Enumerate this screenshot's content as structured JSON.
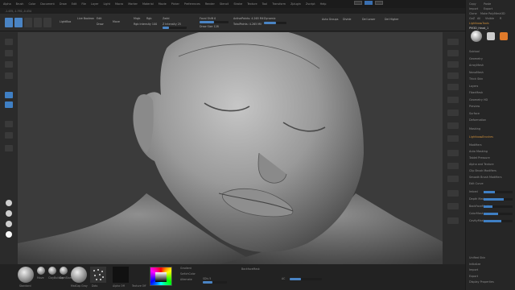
{
  "menu": [
    "Alpha",
    "Brush",
    "Color",
    "Document",
    "Draw",
    "Edit",
    "File",
    "Layer",
    "Light",
    "Macro",
    "Marker",
    "Material",
    "Movie",
    "Picker",
    "Preferences",
    "Render",
    "Stencil",
    "Stroke",
    "Texture",
    "Tool",
    "Transform",
    "Zplugin",
    "Zscript",
    "Help"
  ],
  "coords": "-1.435,-1.792,-0.434",
  "toolbar": {
    "lightbox": "LightBox",
    "live_boolean": "Live Boolean",
    "edit": "Edit",
    "draw": "Draw",
    "move": "Move",
    "scale": "Scale",
    "rotate": "Rotate",
    "mrgb": "Mrgb",
    "rgb": "Rgb",
    "m": "M",
    "zadd": "Zadd",
    "zsub": "Zsub",
    "zcut": "Zcut",
    "focal_shift": "Focal Shift 0",
    "draw_size": "Draw Size 128",
    "z_intensity": "Z Intensity 25",
    "rgb_intensity": "Rgb Intensity 100",
    "dynamic": "Dynamic",
    "activepoints": "ActivePoints: 4.265 Mil",
    "totalpoints": "TotalPoints: 4.265 Mil",
    "auto_groups": "Auto Groups",
    "divide": "Divide",
    "del_lower": "Del Lower",
    "del_higher": "Del Higher"
  },
  "levels": {
    "focal_shift": 0.5,
    "draw_size": 0.55,
    "z_intensity": 0.25,
    "rgb_intensity": 1.0
  },
  "panel": {
    "header": [
      "Copy",
      "Paste",
      "Import",
      "Export",
      "Clone",
      "Make PolyMesh3D",
      "GoZ",
      "All",
      "Visible",
      "R"
    ],
    "lightbox_tools": "Lightbox▸Tools",
    "current_tool": "PM3D_Head_1",
    "sections": [
      "Subtool",
      "Geometry",
      "ArrayMesh",
      "NanoMesh",
      "Thick Skin",
      "Layers",
      "FiberMesh",
      "Geometry HD",
      "Preview",
      "Surface",
      "Deformation"
    ],
    "masking_label": "Masking",
    "lightbox_brushes": "Lightbox▸Brushes",
    "brush_sections": [
      "Modifiers",
      "Auto Masking",
      "Tablet Pressure",
      "Alpha and Texture",
      "Clip Brush Modifiers",
      "Smooth Brush Modifiers",
      "Edit Curve"
    ],
    "sliders": [
      "Imbed",
      "Depth Mask",
      "BackFaceMask",
      "ColorMask",
      "CavityMask"
    ],
    "slider_levels": [
      0.4,
      0.7,
      0.3,
      0.5,
      0.6
    ],
    "bottom_items": [
      "Unified Skin",
      "Initialize",
      "Import",
      "Export",
      "Display Properties"
    ]
  },
  "bottom": {
    "labels": [
      "Standard",
      "Move",
      "ClayBuildup",
      "DamStandard",
      "Dots",
      "Alpha Off",
      "Texture Off",
      "MatCap Gray"
    ],
    "gradient": "Gradient",
    "switch_color": "SwitchColor",
    "alternate": "Alternate",
    "sdiv": "SDiv 5",
    "focal_level": 0.4,
    "backface": "BackfaceMask",
    "ac": "AC",
    "ac_level": 0.35
  }
}
